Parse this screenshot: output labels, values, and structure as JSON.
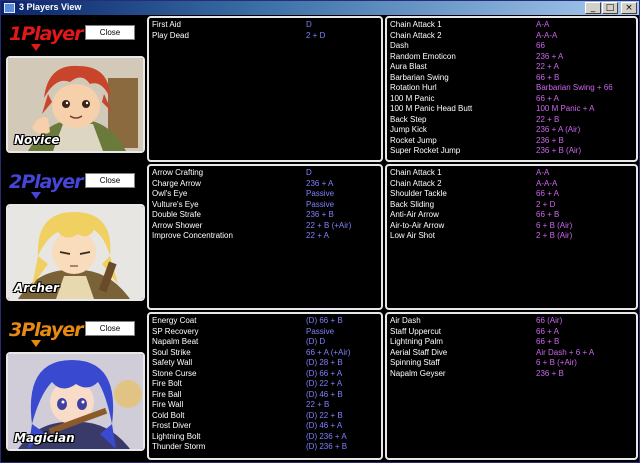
{
  "window": {
    "title": "3 Players View",
    "controls": {
      "minimize": "_",
      "maximize": "□",
      "close": "×"
    }
  },
  "players": [
    {
      "label_main": "1Player",
      "job": "Novice",
      "close_label": "Close",
      "color": "#e21818",
      "marker_color": "#e21818"
    },
    {
      "label_main": "2Player",
      "job": "Archer",
      "close_label": "Close",
      "color": "#4545d8",
      "marker_color": "#4545d8"
    },
    {
      "label_main": "3Player",
      "job": "Magician",
      "close_label": "Close",
      "color": "#e88a12",
      "marker_color": "#e88a12"
    }
  ],
  "panels": {
    "p1_left": {
      "color": "#8080ff",
      "rows": [
        {
          "skill": "First Aid",
          "cmd": "D"
        },
        {
          "skill": "Play Dead",
          "cmd": "2 + D"
        }
      ]
    },
    "p1_right": {
      "color": "#cc66ee",
      "rows": [
        {
          "skill": "Chain Attack 1",
          "cmd": "A-A"
        },
        {
          "skill": "Chain Attack 2",
          "cmd": "A-A-A"
        },
        {
          "skill": "Dash",
          "cmd": "66"
        },
        {
          "skill": "Random Emoticon",
          "cmd": "236 + A"
        },
        {
          "skill": "Aura Blast",
          "cmd": "22 + A"
        },
        {
          "skill": "Barbarian Swing",
          "cmd": "66 + B"
        },
        {
          "skill": "Rotation Hurl",
          "cmd": "Barbarian Swing + 66"
        },
        {
          "skill": "100 M Panic",
          "cmd": "66 + A"
        },
        {
          "skill": "100 M Panic Head Butt",
          "cmd": "100 M Panic + A"
        },
        {
          "skill": "Back Step",
          "cmd": "22 + B"
        },
        {
          "skill": "Jump Kick",
          "cmd": "236 + A (Air)"
        },
        {
          "skill": "Rocket Jump",
          "cmd": "236 + B"
        },
        {
          "skill": "Super Rocket Jump",
          "cmd": "236 + B (Air)"
        }
      ]
    },
    "p2_left": {
      "color": "#8080ff",
      "rows": [
        {
          "skill": "Arrow Crafting",
          "cmd": "D"
        },
        {
          "skill": "Charge Arrow",
          "cmd": "236 + A"
        },
        {
          "skill": "Owl's Eye",
          "cmd": "Passive"
        },
        {
          "skill": "Vulture's Eye",
          "cmd": "Passive"
        },
        {
          "skill": "Double Strafe",
          "cmd": "236 + B"
        },
        {
          "skill": "Arrow Shower",
          "cmd": "22 + B (+Air)"
        },
        {
          "skill": "Improve Concentration",
          "cmd": "22 + A"
        }
      ]
    },
    "p2_right": {
      "color": "#cc66ee",
      "rows": [
        {
          "skill": "Chain Attack 1",
          "cmd": "A-A"
        },
        {
          "skill": "Chain Attack 2",
          "cmd": "A-A-A"
        },
        {
          "skill": "Shoulder Tackle",
          "cmd": "66 + A"
        },
        {
          "skill": "Back Sliding",
          "cmd": "2 + D"
        },
        {
          "skill": "Anti-Air Arrow",
          "cmd": "66 + B"
        },
        {
          "skill": "Air-to-Air Arrow",
          "cmd": "6 + B (Air)"
        },
        {
          "skill": "Low Air Shot",
          "cmd": "2 + B (Air)"
        }
      ]
    },
    "p3_left": {
      "color": "#8080ff",
      "rows": [
        {
          "skill": "Energy Coat",
          "cmd": "(D) 66 + B"
        },
        {
          "skill": "SP Recovery",
          "cmd": "Passive"
        },
        {
          "skill": "Napalm Beat",
          "cmd": "(D) D"
        },
        {
          "skill": "Soul Strike",
          "cmd": "66 + A (+Air)"
        },
        {
          "skill": "Safety Wall",
          "cmd": "(D) 28 + B"
        },
        {
          "skill": "Stone Curse",
          "cmd": "(D) 66 + A"
        },
        {
          "skill": "Fire Bolt",
          "cmd": "(D) 22 + A"
        },
        {
          "skill": "Fire Ball",
          "cmd": "(D) 46 + B"
        },
        {
          "skill": "Fire Wall",
          "cmd": "22 + B"
        },
        {
          "skill": "Cold Bolt",
          "cmd": "(D) 22 + B"
        },
        {
          "skill": "Frost Diver",
          "cmd": "(D) 46 + A"
        },
        {
          "skill": "Lightning Bolt",
          "cmd": "(D) 236 + A"
        },
        {
          "skill": "Thunder Storm",
          "cmd": "(D) 236 + B"
        }
      ]
    },
    "p3_right": {
      "color": "#cc66ee",
      "rows": [
        {
          "skill": "Air Dash",
          "cmd": "66 (Air)"
        },
        {
          "skill": "Staff Uppercut",
          "cmd": "66 + A"
        },
        {
          "skill": "Lightning Palm",
          "cmd": "66 + B"
        },
        {
          "skill": "Aerial Staff Dive",
          "cmd": "Air Dash + 6 + A"
        },
        {
          "skill": "Spinning Staff",
          "cmd": "6 + B (+Air)"
        },
        {
          "skill": "Napalm Geyser",
          "cmd": "236 + B"
        }
      ]
    }
  }
}
